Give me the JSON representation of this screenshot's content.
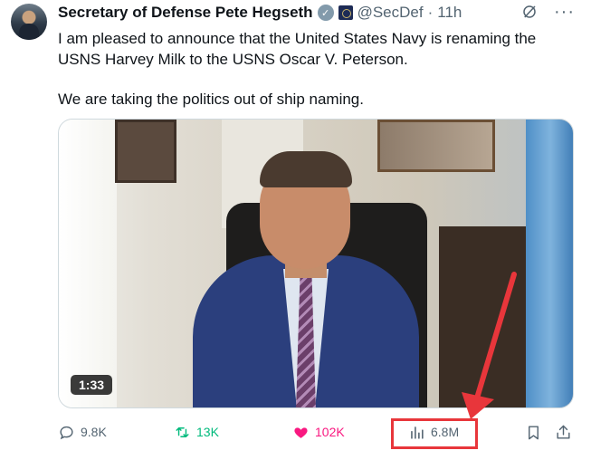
{
  "tweet": {
    "author_name": "Secretary of Defense Pete Hegseth",
    "handle": "@SecDef",
    "separator": "·",
    "time": "11h",
    "more": "···",
    "text_lines": [
      "I am pleased to announce that the United States Navy is renaming the USNS Harvey Milk to the USNS Oscar V. Peterson.",
      "We are taking the politics out of ship naming."
    ],
    "video": {
      "duration": "1:33"
    },
    "stats": {
      "replies": "9.8K",
      "retweets": "13K",
      "likes": "102K",
      "views": "6.8M"
    }
  },
  "icons": {
    "verified": "verified-badge-icon",
    "affiliation": "government-seal-icon",
    "grok": "grok-icon",
    "more": "more-icon",
    "reply": "reply-icon",
    "retweet": "retweet-icon",
    "like": "heart-icon",
    "views": "views-chart-icon",
    "bookmark": "bookmark-icon",
    "share": "share-icon"
  },
  "colors": {
    "retweet": "#00ba7c",
    "like": "#f91880",
    "muted": "#536471",
    "annotation": "#e8363b"
  }
}
